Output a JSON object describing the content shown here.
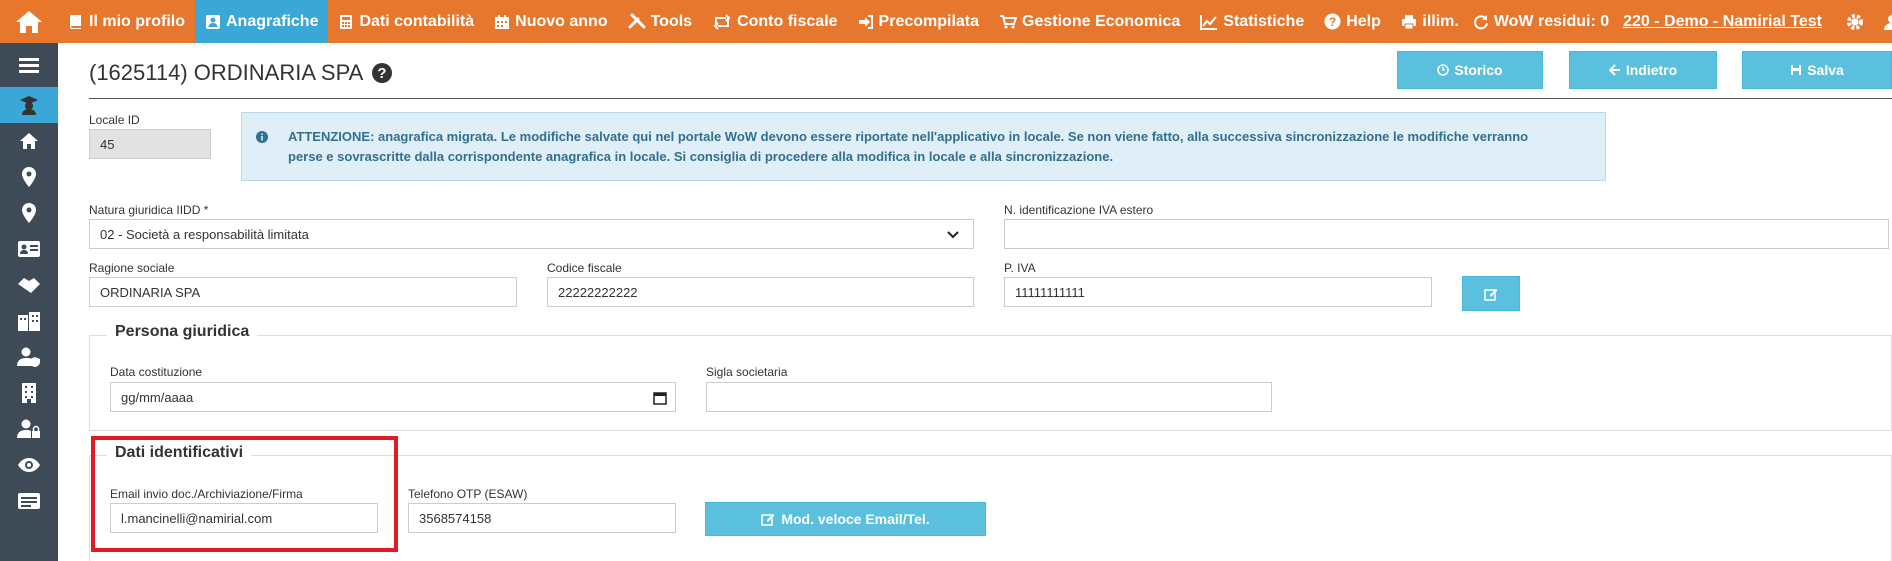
{
  "nav": {
    "items": [
      {
        "label": "Il mio profilo",
        "icon": "book-icon"
      },
      {
        "label": "Anagrafiche",
        "icon": "user-card-icon",
        "active": true
      },
      {
        "label": "Dati contabilità",
        "icon": "calculator-icon"
      },
      {
        "label": "Nuovo anno",
        "icon": "calendar-icon"
      },
      {
        "label": "Tools",
        "icon": "tools-icon"
      },
      {
        "label": "Conto fiscale",
        "icon": "retweet-icon"
      },
      {
        "label": "Precompilata",
        "icon": "sign-in-icon"
      },
      {
        "label": "Gestione Economica",
        "icon": "cart-icon"
      },
      {
        "label": "Statistiche",
        "icon": "chart-icon"
      },
      {
        "label": "Help",
        "icon": "question-icon"
      }
    ],
    "printer_label": "illim.",
    "wow_label": "WoW residui: 0",
    "demo_link": "220 - Demo - Namirial Test"
  },
  "page": {
    "title": "(1625114) ORDINARIA SPA"
  },
  "buttons": {
    "storico": "Storico",
    "indietro": "Indietro",
    "salva": "Salva",
    "mod_veloce": "Mod. veloce Email/Tel."
  },
  "form": {
    "locale_id": {
      "label": "Locale ID",
      "value": "45"
    },
    "alert": {
      "bold": "ATTENZIONE:",
      "line1": " anagrafica migrata. Le modifiche salvate qui nel portale WoW devono essere riportate nell'applicativo in locale. Se non viene fatto, alla successiva sincronizzazione le modifiche verranno",
      "line2": "perse e sovrascritte dalla corrispondente anagrafica in locale. Si consiglia di procedere alla modifica in locale e alla sincronizzazione."
    },
    "natura_giuridica": {
      "label": "Natura giuridica IIDD *",
      "value": "02 - Società a responsabilità limitata"
    },
    "n_iva_estero": {
      "label": "N. identificazione IVA estero",
      "value": ""
    },
    "ragione_sociale": {
      "label": "Ragione sociale",
      "value": "ORDINARIA SPA"
    },
    "codice_fiscale": {
      "label": "Codice fiscale",
      "value": "22222222222"
    },
    "p_iva": {
      "label": "P. IVA",
      "value": "11111111111"
    },
    "persona_giuridica": {
      "legend": "Persona giuridica",
      "data_costituzione": {
        "label": "Data costituzione",
        "placeholder": "gg/mm/aaaa"
      },
      "sigla_societaria": {
        "label": "Sigla societaria",
        "value": ""
      }
    },
    "dati_identificativi": {
      "legend": "Dati identificativi",
      "email": {
        "label": "Email invio doc./Archiviazione/Firma",
        "value": "l.mancinelli@namirial.com"
      },
      "telefono": {
        "label": "Telefono OTP (ESAW)",
        "value": "3568574158"
      }
    }
  },
  "colors": {
    "topbar": "#e8772e",
    "active": "#3aa7d6",
    "sidebar": "#3e4a56",
    "button": "#5bc0de",
    "highlight": "#e01b24"
  }
}
